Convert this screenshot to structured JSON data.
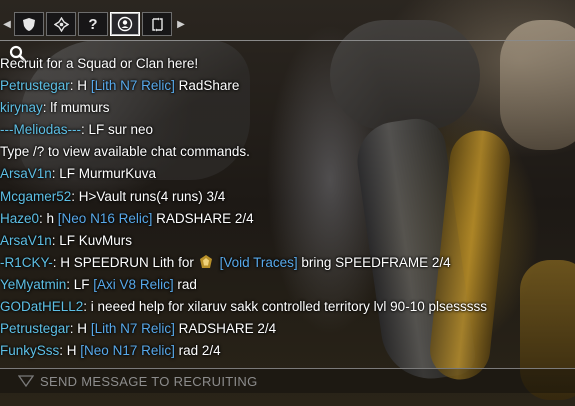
{
  "tabs": [
    {
      "icon": "shield-icon",
      "label": ""
    },
    {
      "icon": "target-icon",
      "label": ""
    },
    {
      "icon": "help-icon",
      "label": "?"
    },
    {
      "icon": "recruit-icon",
      "label": ""
    },
    {
      "icon": "trade-icon",
      "label": ""
    }
  ],
  "chat": {
    "lines": [
      {
        "parts": [
          {
            "t": "Recruit for a Squad or Clan here!",
            "c": "text"
          }
        ]
      },
      {
        "parts": [
          {
            "t": "Petrustegar",
            "c": "name"
          },
          {
            "t": ": H ",
            "c": "text"
          },
          {
            "t": "[Lith N7 Relic]",
            "c": "relic"
          },
          {
            "t": " RadShare",
            "c": "text"
          }
        ]
      },
      {
        "parts": [
          {
            "t": "kirynay",
            "c": "name"
          },
          {
            "t": ": lf mumurs",
            "c": "text"
          }
        ]
      },
      {
        "parts": [
          {
            "t": "---Meliodas---",
            "c": "name"
          },
          {
            "t": ": LF sur neo",
            "c": "text"
          }
        ]
      },
      {
        "parts": [
          {
            "t": "Type /? to view available chat commands.",
            "c": "text"
          }
        ]
      },
      {
        "parts": [
          {
            "t": "ArsaV1n",
            "c": "name"
          },
          {
            "t": ": LF MurmurKuva",
            "c": "text"
          }
        ]
      },
      {
        "parts": [
          {
            "t": "Mcgamer52",
            "c": "name"
          },
          {
            "t": ": H>Vault runs(4 runs) 3/4",
            "c": "text"
          }
        ]
      },
      {
        "parts": [
          {
            "t": "Haze0",
            "c": "name"
          },
          {
            "t": ": h ",
            "c": "text"
          },
          {
            "t": "[Neo N16 Relic]",
            "c": "relic"
          },
          {
            "t": "  RADSHARE 2/4",
            "c": "text"
          }
        ]
      },
      {
        "parts": [
          {
            "t": "ArsaV1n",
            "c": "name"
          },
          {
            "t": ": LF KuvMurs",
            "c": "text"
          }
        ]
      },
      {
        "parts": [
          {
            "t": "-R1CKY-",
            "c": "name"
          },
          {
            "t": ": H SPEEDRUN Lith for",
            "c": "text"
          },
          {
            "t": "",
            "c": "icon"
          },
          {
            "t": " [Void Traces]",
            "c": "relic"
          },
          {
            "t": "  bring SPEEDFRAME 2/4",
            "c": "text"
          }
        ]
      },
      {
        "parts": [
          {
            "t": "YeMyatmin",
            "c": "name"
          },
          {
            "t": ": LF ",
            "c": "text"
          },
          {
            "t": "[Axi V8 Relic]",
            "c": "relic"
          },
          {
            "t": " rad",
            "c": "text"
          }
        ]
      },
      {
        "parts": [
          {
            "t": "GODatHELL2",
            "c": "name"
          },
          {
            "t": ": i neeed help for xilaruv sakk controlled territory lvl 90-10 plsesssss",
            "c": "text"
          }
        ]
      },
      {
        "parts": [
          {
            "t": "Petrustegar",
            "c": "name"
          },
          {
            "t": ": H ",
            "c": "text"
          },
          {
            "t": "[Lith N7 Relic]",
            "c": "relic"
          },
          {
            "t": " RADSHARE 2/4",
            "c": "text"
          }
        ]
      },
      {
        "parts": [
          {
            "t": "FunkySss",
            "c": "name"
          },
          {
            "t": ": H ",
            "c": "text"
          },
          {
            "t": "[Neo N17 Relic]",
            "c": "relic"
          },
          {
            "t": " rad 2/4",
            "c": "text"
          }
        ]
      }
    ]
  },
  "input": {
    "placeholder": "SEND MESSAGE TO RECRUITING"
  },
  "colors": {
    "name": "#5ec0e6",
    "relic": "#58a9ea",
    "text": "#ffffff"
  }
}
